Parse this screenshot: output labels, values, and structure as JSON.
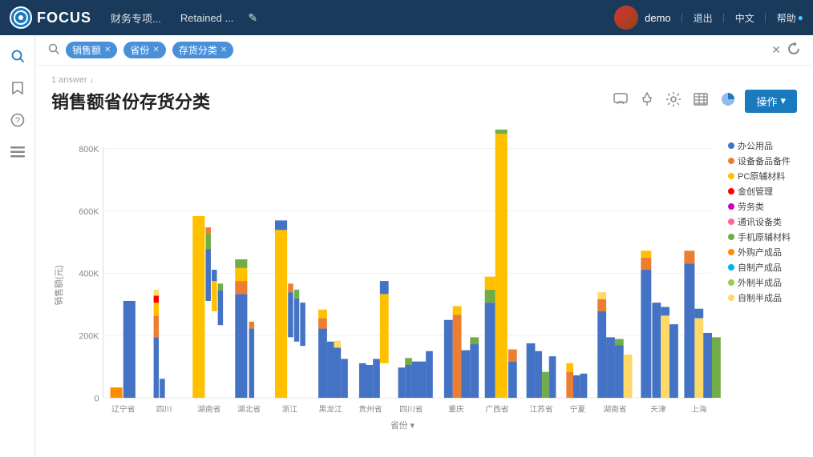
{
  "topnav": {
    "logo": "FOCUS",
    "nav_items": [
      "财务专项...",
      "Retained ..."
    ],
    "edit_icon": "✎",
    "username": "demo",
    "actions": [
      "退出",
      "中文",
      "帮助"
    ],
    "divider": "｜"
  },
  "search": {
    "placeholder": "搜索",
    "tags": [
      {
        "label": "销售额",
        "key": "sales"
      },
      {
        "label": "省份",
        "key": "province"
      },
      {
        "label": "存货分类",
        "key": "inventory"
      }
    ],
    "clear_title": "清除",
    "refresh_title": "刷新"
  },
  "breadcrumb": "1 answer ↓",
  "page_title": "销售额省份存货分类",
  "toolbar": {
    "operate_label": "操作",
    "operate_arrow": "▾"
  },
  "chart": {
    "y_label": "销售额(元)",
    "x_label": "省份",
    "y_axis": [
      "0",
      "200K",
      "400K",
      "600K",
      "800K"
    ],
    "x_axis": [
      "辽宁省",
      "四川",
      "湖南省",
      "湖北省",
      "浙江",
      "黑龙江",
      "贵州省",
      "四川省",
      "重庆",
      "广西省",
      "江苏省",
      "宁夏",
      "湖南省",
      "天津",
      "上海"
    ],
    "legend": [
      {
        "label": "办公用品",
        "color": "#4472c4"
      },
      {
        "label": "设备备品备件",
        "color": "#ed7d31"
      },
      {
        "label": "PC原辅材料",
        "color": "#ffc000"
      },
      {
        "label": "金创管理",
        "color": "#ff0000"
      },
      {
        "label": "劳务类",
        "color": "#cc00cc"
      },
      {
        "label": "通讯设备类",
        "color": "#ff6699"
      },
      {
        "label": "手机原辅材料",
        "color": "#70ad47"
      },
      {
        "label": "外购产成品",
        "color": "#ff8c00"
      },
      {
        "label": "自制产成品",
        "color": "#00b0f0"
      },
      {
        "label": "外制半成品",
        "color": "#92d050"
      },
      {
        "label": "自制半成品",
        "color": "#ffd966"
      }
    ]
  }
}
